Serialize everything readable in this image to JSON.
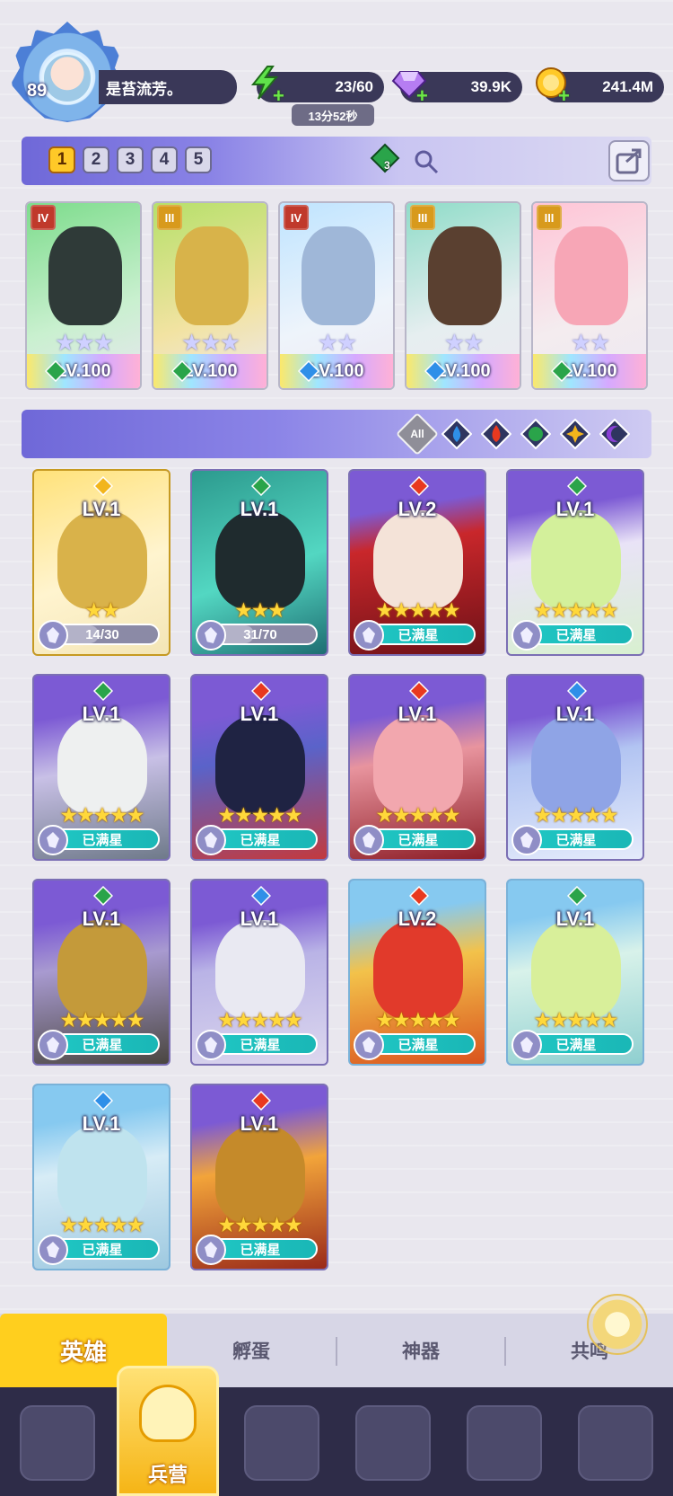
{
  "player": {
    "level": "89",
    "name": "是苔流芳。"
  },
  "resources": {
    "stamina": "23/60",
    "stamina_timer": "13分52秒",
    "gems": "39.9K",
    "coins": "241.4M"
  },
  "team": {
    "slots": [
      "1",
      "2",
      "3",
      "4",
      "5"
    ],
    "active_slot": "1",
    "gem_count": "3",
    "heroes": [
      {
        "rank": "IV",
        "level": "LV.100",
        "element": "wind",
        "stars": "★★★"
      },
      {
        "rank": "III",
        "level": "LV.100",
        "element": "wind",
        "stars": "★★★"
      },
      {
        "rank": "IV",
        "level": "LV.100",
        "element": "water",
        "stars": "★★"
      },
      {
        "rank": "III",
        "level": "LV.100",
        "element": "water",
        "stars": "★★"
      },
      {
        "rank": "III",
        "level": "LV.100",
        "element": "wind",
        "stars": "★★"
      }
    ]
  },
  "filters": {
    "all_label": "All",
    "elements": [
      "water",
      "fire",
      "wind",
      "light",
      "dark"
    ]
  },
  "heroes": [
    {
      "level": "LV.1",
      "element": "light",
      "stars": "★★",
      "status": "14/30",
      "progress": 0.47
    },
    {
      "level": "LV.1",
      "element": "wind",
      "stars": "★★★",
      "status": "31/70",
      "progress": 0.44
    },
    {
      "level": "LV.2",
      "element": "fire",
      "stars": "★★★★★",
      "status": "已满星",
      "progress": 1
    },
    {
      "level": "LV.1",
      "element": "wind",
      "stars": "★★★★★",
      "status": "已满星",
      "progress": 1
    },
    {
      "level": "LV.1",
      "element": "wind",
      "stars": "★★★★★",
      "status": "已满星",
      "progress": 1
    },
    {
      "level": "LV.1",
      "element": "fire",
      "stars": "★★★★★",
      "status": "已满星",
      "progress": 1
    },
    {
      "level": "LV.1",
      "element": "fire",
      "stars": "★★★★★",
      "status": "已满星",
      "progress": 1
    },
    {
      "level": "LV.1",
      "element": "water",
      "stars": "★★★★★",
      "status": "已满星",
      "progress": 1
    },
    {
      "level": "LV.1",
      "element": "wind",
      "stars": "★★★★★",
      "status": "已满星",
      "progress": 1
    },
    {
      "level": "LV.1",
      "element": "water",
      "stars": "★★★★★",
      "status": "已满星",
      "progress": 1
    },
    {
      "level": "LV.2",
      "element": "fire",
      "stars": "★★★★★",
      "status": "已满星",
      "progress": 1
    },
    {
      "level": "LV.1",
      "element": "wind",
      "stars": "★★★★★",
      "status": "已满星",
      "progress": 1
    },
    {
      "level": "LV.1",
      "element": "water",
      "stars": "★★★★★",
      "status": "已满星",
      "progress": 1
    },
    {
      "level": "LV.1",
      "element": "fire",
      "stars": "★★★★★",
      "status": "已满星",
      "progress": 1
    }
  ],
  "tabs": [
    "英雄",
    "孵蛋",
    "神器",
    "共鸣"
  ],
  "nav": {
    "active_label": "兵营",
    "items": [
      "cards-icon",
      "barracks-icon",
      "book-icon",
      "castle-icon",
      "mushroom-icon",
      "scroll-icon"
    ]
  },
  "colors": {
    "water": "#2f8fe8",
    "fire": "#e8391f",
    "wind": "#2aa44a",
    "light": "#f2b51c",
    "dark": "#8a3fd6",
    "accent": "#ffcf1e",
    "full_bar": "#1fc7c4"
  }
}
